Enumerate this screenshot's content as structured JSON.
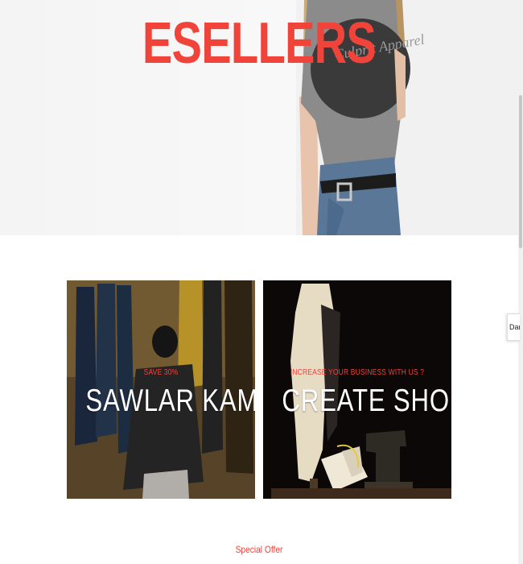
{
  "hero": {
    "brand_title": "ESELLERS",
    "shirt_print": "Culprit Apparel"
  },
  "banners": [
    {
      "subtitle": "SAVE 30%",
      "title": "SAWLAR KAMIZ"
    },
    {
      "subtitle": "INCREASE YOUR BUSINESS WITH US ?",
      "title": "CREATE SHOP"
    }
  ],
  "dark_toggle": {
    "label": "Dark"
  },
  "special_offer": {
    "label": "Special Offer"
  },
  "colors": {
    "accent": "#f0433a",
    "banner_text": "#ffffff"
  }
}
